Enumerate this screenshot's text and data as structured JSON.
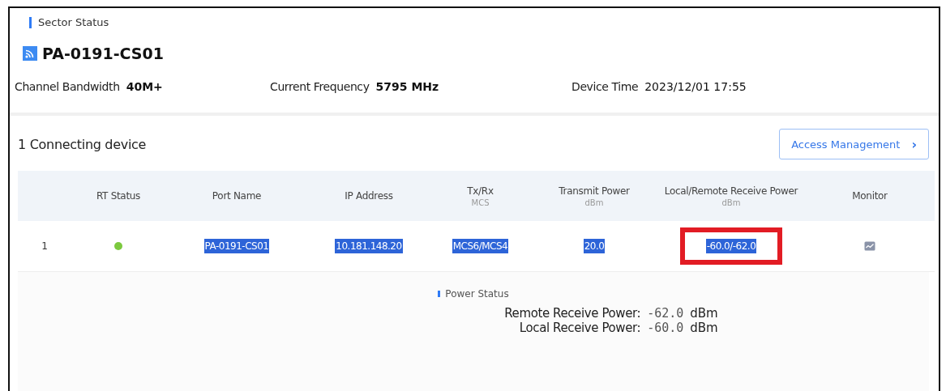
{
  "section_title": "Sector Status",
  "device": {
    "name": "PA-0191-CS01"
  },
  "info": [
    {
      "label": "Channel Bandwidth",
      "value": "40M+",
      "bold": true
    },
    {
      "label": "Current Frequency",
      "value": "5795 MHz",
      "bold": true
    },
    {
      "label": "Device Time",
      "value": "2023/12/01  17:55",
      "bold": false
    }
  ],
  "connecting": {
    "count": "1",
    "label": "Connecting device"
  },
  "access_button": {
    "label": "Access Management",
    "icon": "›"
  },
  "table": {
    "columns": [
      {},
      {
        "label": "RT Status"
      },
      {
        "label": "Port Name"
      },
      {
        "label": "IP Address"
      },
      {
        "label": "Tx/Rx",
        "unit": "MCS"
      },
      {
        "label": "Transmit Power",
        "unit": "dBm"
      },
      {
        "label": "Local/Remote Receive Power",
        "unit": "dBm"
      },
      {
        "label": "Monitor"
      }
    ],
    "rows": [
      {
        "cells": [
          {
            "kind": "number",
            "text": "1"
          },
          {
            "kind": "status",
            "color": "#7cc93f"
          },
          {
            "text": "PA-0191-CS01",
            "highlighted": true,
            "annotated": false
          },
          {
            "text": "10.181.148.20",
            "highlighted": true,
            "annotated": false
          },
          {
            "text": "MCS6/MCS4",
            "highlighted": true,
            "annotated": false
          },
          {
            "text": "20.0",
            "highlighted": true,
            "annotated": false
          },
          {
            "text": "-60.0/-62.0",
            "highlighted": true,
            "annotated": true
          },
          {
            "kind": "monitor"
          }
        ]
      }
    ]
  },
  "power_status": {
    "title": "Power Status",
    "lines": [
      {
        "label": "Remote Receive Power:",
        "value": "-62.0",
        "unit": "dBm"
      },
      {
        "label": "Local Receive Power:",
        "value": "-60.0",
        "unit": "dBm"
      }
    ]
  }
}
